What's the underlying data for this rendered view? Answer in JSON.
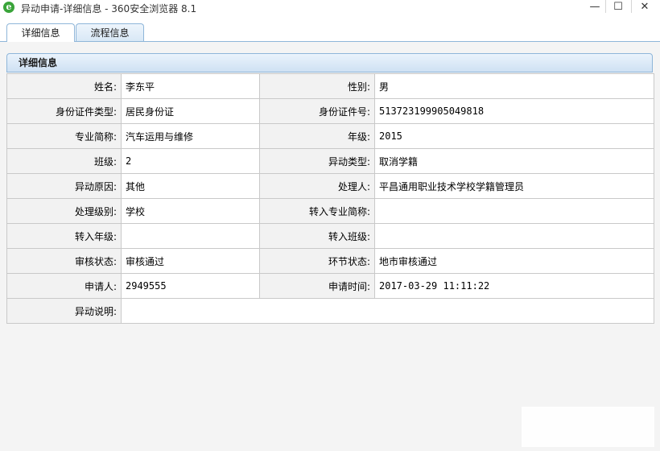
{
  "window": {
    "title": "异动申请-详细信息 - 360安全浏览器 8.1",
    "icon": "ie-e-icon",
    "controls": {
      "minimize": "—",
      "maximize": "☐",
      "close": "✕"
    }
  },
  "tabs": [
    {
      "label": "详细信息",
      "active": true
    },
    {
      "label": "流程信息",
      "active": false
    }
  ],
  "panel": {
    "title": "详细信息",
    "rows": [
      {
        "l1": "姓名:",
        "v1": "李东平",
        "l2": "性别:",
        "v2": "男"
      },
      {
        "l1": "身份证件类型:",
        "v1": "居民身份证",
        "l2": "身份证件号:",
        "v2": "513723199905049818"
      },
      {
        "l1": "专业简称:",
        "v1": "汽车运用与维修",
        "l2": "年级:",
        "v2": "2015"
      },
      {
        "l1": "班级:",
        "v1": "2",
        "l2": "异动类型:",
        "v2": "取消学籍"
      },
      {
        "l1": "异动原因:",
        "v1": "其他",
        "l2": "处理人:",
        "v2": "平昌通用职业技术学校学籍管理员"
      },
      {
        "l1": "处理级别:",
        "v1": "学校",
        "l2": "转入专业简称:",
        "v2": ""
      },
      {
        "l1": "转入年级:",
        "v1": "",
        "l2": "转入班级:",
        "v2": ""
      },
      {
        "l1": "审核状态:",
        "v1": "审核通过",
        "l2": "环节状态:",
        "v2": "地市审核通过"
      },
      {
        "l1": "申请人:",
        "v1": "2949555",
        "l2": "申请时间:",
        "v2": "2017-03-29 11:11:22"
      }
    ],
    "note_label": "异动说明:",
    "note_value": ""
  },
  "colors": {
    "tab_border": "#8fb6d9",
    "label_bg": "#f2f2f2",
    "grid": "#c9c9c9"
  }
}
